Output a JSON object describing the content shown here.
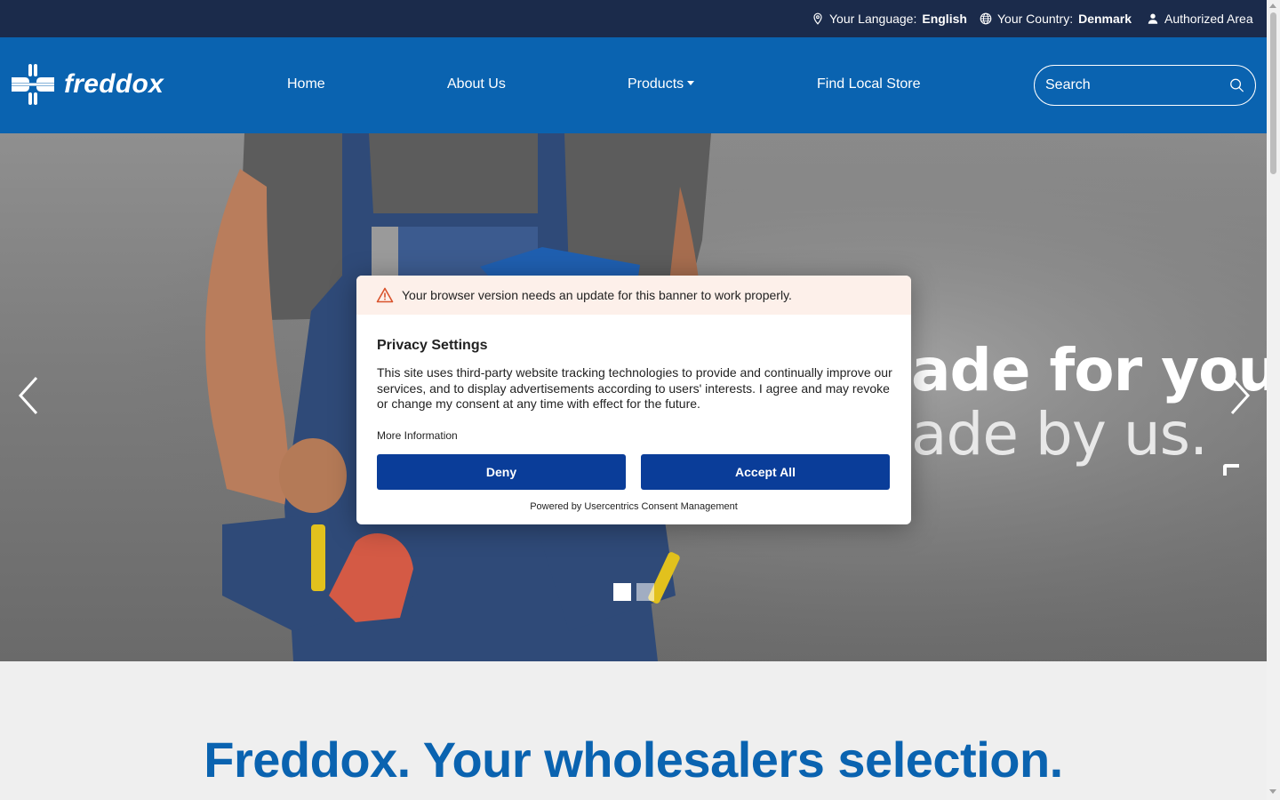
{
  "topbar": {
    "language_label": "Your Language:",
    "language_value": "English",
    "country_label": "Your Country:",
    "country_value": "Denmark",
    "authorized_area": "Authorized Area"
  },
  "nav": {
    "logo_text": "freddox",
    "items": [
      "Home",
      "About Us",
      "Products",
      "Find Local Store"
    ],
    "search_placeholder": "Search"
  },
  "hero": {
    "line1": "ade for you.",
    "line2": "ade by us.",
    "slides": 2,
    "active_slide": 1
  },
  "consent": {
    "warning": "Your browser version needs an update for this banner to work properly.",
    "title": "Privacy Settings",
    "body": "This site uses third-party website tracking technologies to provide and continually improve our services, and to display advertisements according to users' interests. I agree and may revoke or change my consent at any time with effect for the future.",
    "more_info": "More Information",
    "deny_label": "Deny",
    "accept_label": "Accept All",
    "powered_by": "Powered by Usercentrics Consent Management"
  },
  "section": {
    "headline": "Freddox. Your wholesalers selection."
  },
  "colors": {
    "topbar_bg": "#1b2b4b",
    "nav_bg": "#0a63b0",
    "button_bg": "#0a3d99",
    "warning_bg": "#fdf0ea",
    "headline": "#0a63b0"
  }
}
